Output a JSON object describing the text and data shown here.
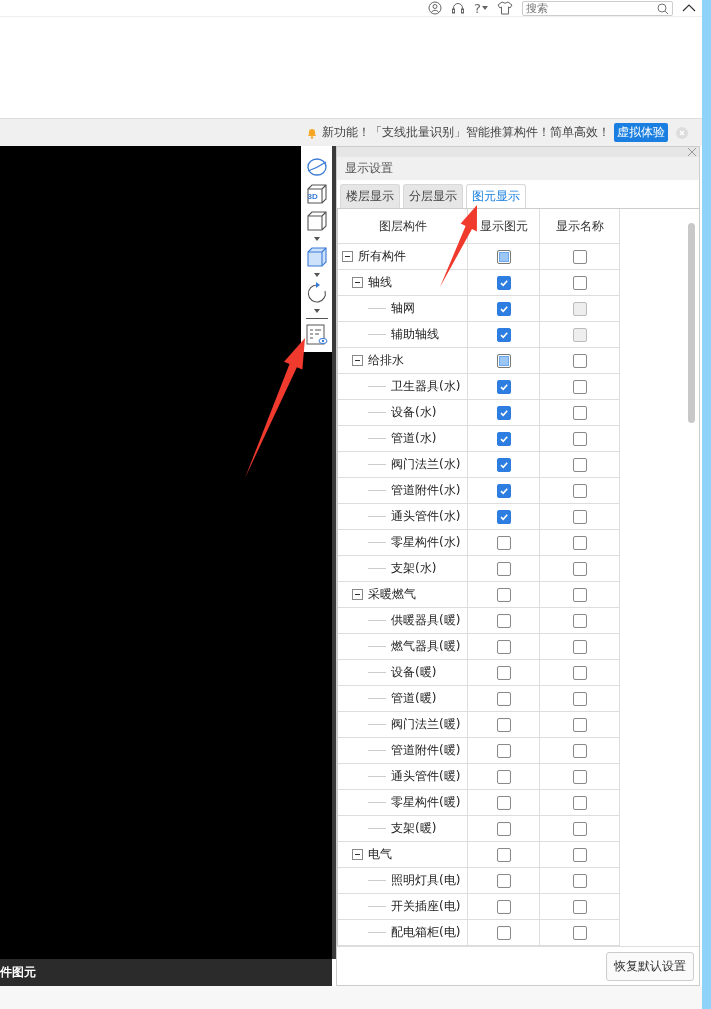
{
  "top_bar": {
    "help_label": "?",
    "search": {
      "placeholder": "搜索"
    }
  },
  "notice": {
    "text": "新功能！「支线批量识别」智能推算构件！简单高效！",
    "button": "虚拟体验"
  },
  "canvas": {
    "status_text": "件图元",
    "toolbar_3d_label": "3D"
  },
  "panel": {
    "title": "显示设置",
    "tabs": [
      {
        "label": "楼层显示",
        "selected": false
      },
      {
        "label": "分层显示",
        "selected": false
      },
      {
        "label": "图元显示",
        "selected": true
      }
    ],
    "columns": [
      "图层构件",
      "显示图元",
      "显示名称"
    ],
    "tree": [
      {
        "label": "所有构件",
        "expanded": true,
        "checked": false,
        "partial": true,
        "name_checked": false,
        "name_disabled": false,
        "children": [
          {
            "label": "轴线",
            "expanded": true,
            "checked": true,
            "partial": false,
            "name_checked": false,
            "name_disabled": false,
            "children": [
              {
                "label": "轴网",
                "checked": true,
                "partial": false,
                "name_checked": false,
                "name_disabled": true
              },
              {
                "label": "辅助轴线",
                "checked": true,
                "partial": false,
                "name_checked": false,
                "name_disabled": true
              }
            ]
          },
          {
            "label": "给排水",
            "expanded": true,
            "checked": false,
            "partial": true,
            "name_checked": false,
            "name_disabled": false,
            "children": [
              {
                "label": "卫生器具(水)",
                "checked": true,
                "partial": false,
                "name_checked": false,
                "name_disabled": false
              },
              {
                "label": "设备(水)",
                "checked": true,
                "partial": false,
                "name_checked": false,
                "name_disabled": false
              },
              {
                "label": "管道(水)",
                "checked": true,
                "partial": false,
                "name_checked": false,
                "name_disabled": false
              },
              {
                "label": "阀门法兰(水)",
                "checked": true,
                "partial": false,
                "name_checked": false,
                "name_disabled": false
              },
              {
                "label": "管道附件(水)",
                "checked": true,
                "partial": false,
                "name_checked": false,
                "name_disabled": false
              },
              {
                "label": "通头管件(水)",
                "checked": true,
                "partial": false,
                "name_checked": false,
                "name_disabled": false
              },
              {
                "label": "零星构件(水)",
                "checked": false,
                "partial": false,
                "name_checked": false,
                "name_disabled": false
              },
              {
                "label": "支架(水)",
                "checked": false,
                "partial": false,
                "name_checked": false,
                "name_disabled": false
              }
            ]
          },
          {
            "label": "采暖燃气",
            "expanded": true,
            "checked": false,
            "partial": false,
            "name_checked": false,
            "name_disabled": false,
            "children": [
              {
                "label": "供暖器具(暖)",
                "checked": false,
                "partial": false,
                "name_checked": false,
                "name_disabled": false
              },
              {
                "label": "燃气器具(暖)",
                "checked": false,
                "partial": false,
                "name_checked": false,
                "name_disabled": false
              },
              {
                "label": "设备(暖)",
                "checked": false,
                "partial": false,
                "name_checked": false,
                "name_disabled": false
              },
              {
                "label": "管道(暖)",
                "checked": false,
                "partial": false,
                "name_checked": false,
                "name_disabled": false
              },
              {
                "label": "阀门法兰(暖)",
                "checked": false,
                "partial": false,
                "name_checked": false,
                "name_disabled": false
              },
              {
                "label": "管道附件(暖)",
                "checked": false,
                "partial": false,
                "name_checked": false,
                "name_disabled": false
              },
              {
                "label": "通头管件(暖)",
                "checked": false,
                "partial": false,
                "name_checked": false,
                "name_disabled": false
              },
              {
                "label": "零星构件(暖)",
                "checked": false,
                "partial": false,
                "name_checked": false,
                "name_disabled": false
              },
              {
                "label": "支架(暖)",
                "checked": false,
                "partial": false,
                "name_checked": false,
                "name_disabled": false
              }
            ]
          },
          {
            "label": "电气",
            "expanded": true,
            "checked": false,
            "partial": false,
            "name_checked": false,
            "name_disabled": false,
            "children": [
              {
                "label": "照明灯具(电)",
                "checked": false,
                "partial": false,
                "name_checked": false,
                "name_disabled": false
              },
              {
                "label": "开关插座(电)",
                "checked": false,
                "partial": false,
                "name_checked": false,
                "name_disabled": false
              },
              {
                "label": "配电箱柜(电)",
                "checked": false,
                "partial": false,
                "name_checked": false,
                "name_disabled": false
              }
            ]
          }
        ]
      }
    ],
    "restore_button": "恢复默认设置"
  }
}
